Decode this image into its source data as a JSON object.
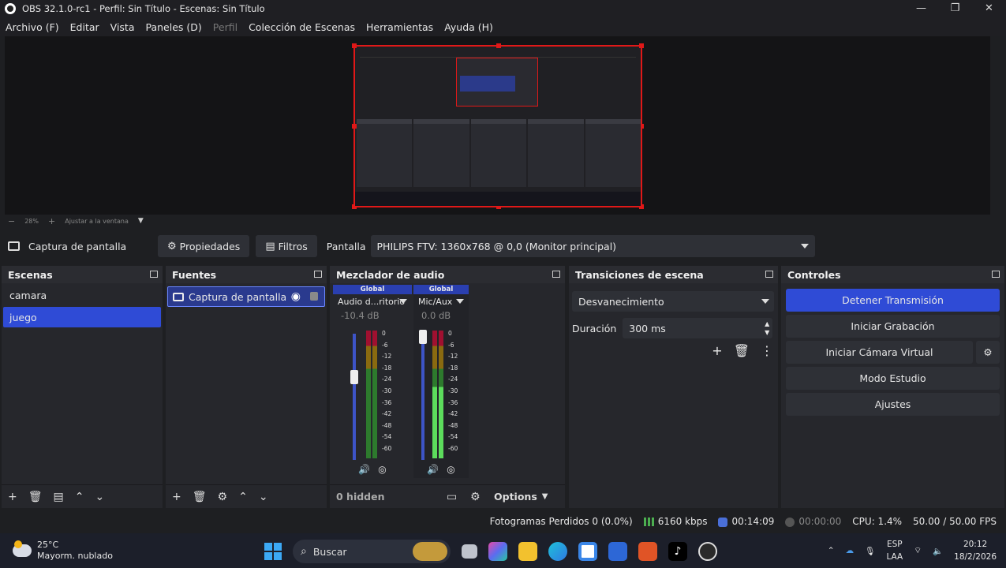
{
  "window": {
    "title": "OBS 32.1.0-rc1 - Perfil: Sin Título - Escenas: Sin Título",
    "minimize": "—",
    "maximize": "❐",
    "close": "✕"
  },
  "menu": [
    "Archivo (F)",
    "Editar",
    "Vista",
    "Paneles (D)",
    "Perfil",
    "Colección de Escenas",
    "Herramientas",
    "Ayuda (H)"
  ],
  "zoom": {
    "minus": "−",
    "level": "28%",
    "plus": "+",
    "fit": "Ajustar a la ventana"
  },
  "source_bar": {
    "source_name": "Captura de pantalla",
    "properties": "Propiedades",
    "filters": "Filtros",
    "display_label": "Pantalla",
    "display_value": "PHILIPS FTV: 1360x768 @ 0,0 (Monitor principal)"
  },
  "scenes": {
    "title": "Escenas",
    "items": [
      "camara",
      "juego"
    ],
    "selected": "juego"
  },
  "sources": {
    "title": "Fuentes",
    "items": [
      "Captura de pantalla"
    ]
  },
  "mixer": {
    "title": "Mezclador de audio",
    "channels": [
      {
        "tag": "Global",
        "name": "Audio d...ritorio",
        "db": "-10.4 dB",
        "level": 0.0
      },
      {
        "tag": "Global",
        "name": "Mic/Aux",
        "db": "0.0 dB",
        "level": 0.75
      }
    ],
    "scale": [
      "0",
      "-6",
      "-12",
      "-18",
      "-24",
      "-30",
      "-36",
      "-42",
      "-48",
      "-54",
      "-60"
    ],
    "hidden": "0 hidden",
    "options": "Options"
  },
  "transitions": {
    "title": "Transiciones de escena",
    "selected": "Desvanecimiento",
    "duration_label": "Duración",
    "duration_value": "300 ms"
  },
  "controls": {
    "title": "Controles",
    "buttons": [
      "Detener Transmisión",
      "Iniciar Grabación",
      "Iniciar Cámara Virtual",
      "Modo Estudio",
      "Ajustes"
    ]
  },
  "status": {
    "dropped": "Fotogramas Perdidos 0 (0.0%)",
    "bitrate": "6160 kbps",
    "stream_time": "00:14:09",
    "rec_time": "00:00:00",
    "cpu": "CPU: 1.4%",
    "fps": "50.00 / 50.00 FPS"
  },
  "taskbar": {
    "temp": "25°C",
    "weather": "Mayorm. nublado",
    "search": "Buscar",
    "lang1": "ESP",
    "lang2": "LAA",
    "time": "20:12",
    "date": "18/2/2026"
  },
  "colors": {
    "accent": "#2f4bd6",
    "preview_border": "#e01818",
    "panel": "#26272c"
  }
}
